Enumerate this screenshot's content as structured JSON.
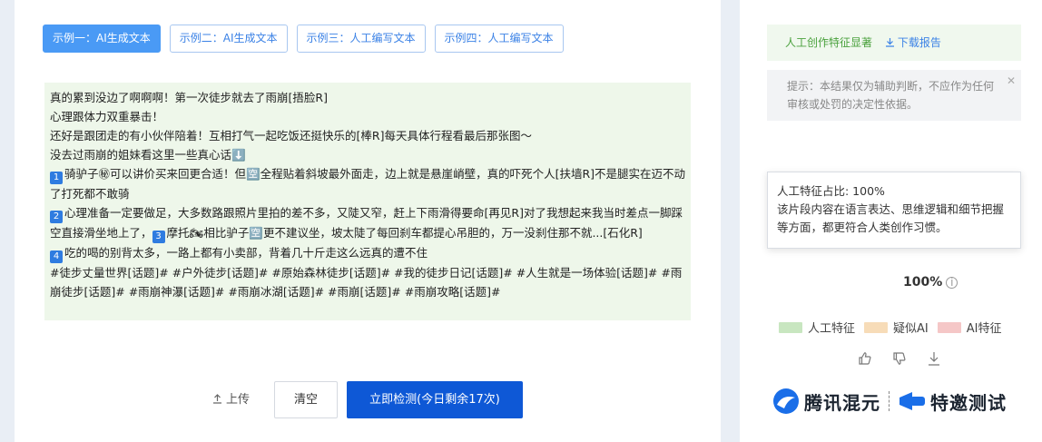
{
  "tabs": [
    {
      "label": "示例一：AI生成文本",
      "active": true
    },
    {
      "label": "示例二：AI生成文本",
      "active": false
    },
    {
      "label": "示例三：人工编写文本",
      "active": false
    },
    {
      "label": "示例四：人工编写文本",
      "active": false
    }
  ],
  "sample_text": {
    "lines": [
      "真的累到没边了啊啊啊！第一次徒步就去了雨崩[捂脸R]",
      "心理跟体力双重暴击！",
      "还好是跟团走的有小伙伴陪着！互相打气一起吃饭还挺快乐的[棒R]每天具体行程看最后那张图～",
      "没去过雨崩的姐妹看这里一些真心话⬇️"
    ],
    "items": [
      {
        "num": "1",
        "text": "骑驴子㊙可以讲价买来回更合适！但🈳全程贴着斜坡最外面走，边上就是悬崖峭壁，真的吓死个人[扶墙R]不是腿实在迈不动了打死都不敢骑"
      },
      {
        "num": "2",
        "text": "心理准备一定要做足，大多数路跟照片里拍的差不多，又陡又窄，赶上下雨滑得要命[再见R]对了我想起来我当时差点一脚踩空直接滑坐地上了，"
      },
      {
        "num": "4",
        "text": "吃的喝的别背太多，一路上都有小卖部，背着几十斤走这么远真的遭不住"
      }
    ],
    "item2_tail_num": "3",
    "item2_tail_text": "摩托🏍相比驴子🈳更不建议坐，坡太陡了每回刹车都提心吊胆的，万一没刹住那不就...[石化R]",
    "tags": "#徒步丈量世界[话题]# #户外徒步[话题]# #原始森林徒步[话题]# #我的徒步日记[话题]# #人生就是一场体验[话题]# #雨崩徒步[话题]# #雨崩神瀑[话题]# #雨崩冰湖[话题]# #雨崩[话题]# #雨崩攻略[话题]#"
  },
  "bottom": {
    "upload_label": "上传",
    "clear_label": "清空",
    "detect_label": "立即检测(今日剩余17次)"
  },
  "result": {
    "title": "人工创作特征显著",
    "download_label": "下载报告",
    "hint": "提示：本结果仅为辅助判断，不应作为任何审核或处罚的决定性依据。",
    "percent_label": "100%",
    "tooltip_title": "人工特征占比: 100%",
    "tooltip_body": "该片段内容在语言表达、思维逻辑和细节把握等方面，都更符合人类创作习惯。",
    "legend": [
      {
        "label": "人工特征",
        "color": "#c8e6c0"
      },
      {
        "label": "疑似AI",
        "color": "#f7dcb8"
      },
      {
        "label": "AI特征",
        "color": "#f5c7c7"
      }
    ],
    "human_fraction": 1.0
  },
  "brand": {
    "name": "腾讯混元",
    "badge": "特邀测试"
  },
  "colors": {
    "primary": "#0e58d6",
    "tab_active": "#4a9af5",
    "human_green": "#c8e6c0",
    "title_green": "#4aa13d"
  }
}
